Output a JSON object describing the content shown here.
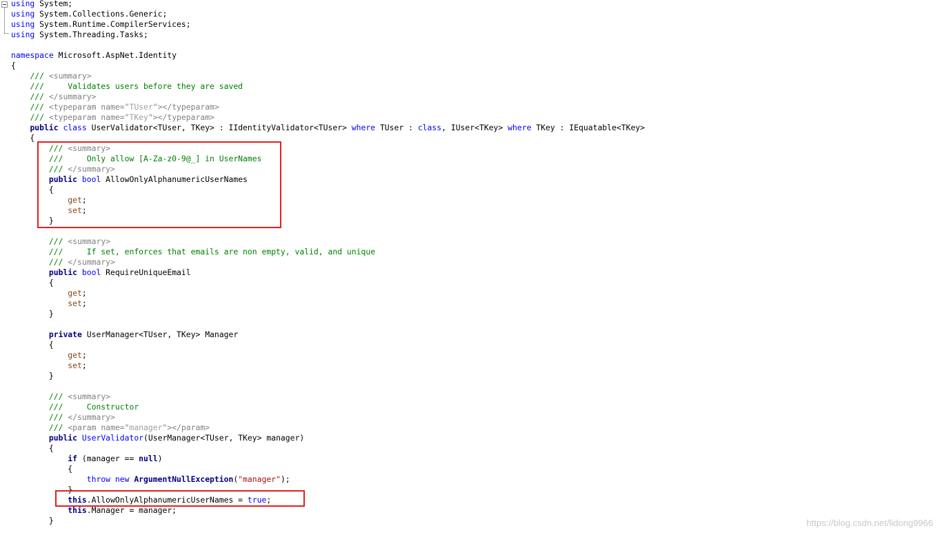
{
  "colors": {
    "keyword": "#0000ff",
    "keyword_bold": "#000080",
    "comment": "#008000",
    "xml_doc": "#808080",
    "string": "#a31515",
    "accessor": "#8b4513",
    "highlight_border": "#e02020",
    "background": "#ffffff"
  },
  "editor": {
    "outline_icon": "collapse-minus-icon",
    "lines": [
      [
        {
          "t": "kw",
          "s": "using"
        },
        {
          "t": "def",
          "s": " System;"
        }
      ],
      [
        {
          "t": "kw",
          "s": "using"
        },
        {
          "t": "def",
          "s": " System.Collections.Generic;"
        }
      ],
      [
        {
          "t": "kw",
          "s": "using"
        },
        {
          "t": "def",
          "s": " System.Runtime.CompilerServices;"
        }
      ],
      [
        {
          "t": "kw",
          "s": "using"
        },
        {
          "t": "def",
          "s": " System.Threading.Tasks;"
        }
      ],
      [],
      [
        {
          "t": "kw",
          "s": "namespace"
        },
        {
          "t": "def",
          "s": " Microsoft.AspNet.Identity"
        }
      ],
      [
        {
          "t": "def",
          "s": "{"
        }
      ],
      [
        {
          "t": "def",
          "s": "    "
        },
        {
          "t": "cmt",
          "s": "/// "
        },
        {
          "t": "xml",
          "s": "<summary>"
        }
      ],
      [
        {
          "t": "def",
          "s": "    "
        },
        {
          "t": "cmt",
          "s": "///     Validates users before they are saved"
        }
      ],
      [
        {
          "t": "def",
          "s": "    "
        },
        {
          "t": "cmt",
          "s": "/// "
        },
        {
          "t": "xml",
          "s": "</summary>"
        }
      ],
      [
        {
          "t": "def",
          "s": "    "
        },
        {
          "t": "cmt",
          "s": "/// "
        },
        {
          "t": "xml",
          "s": "<typeparam name=\""
        },
        {
          "t": "xmlv",
          "s": "TUser"
        },
        {
          "t": "xml",
          "s": "\"></typeparam>"
        }
      ],
      [
        {
          "t": "def",
          "s": "    "
        },
        {
          "t": "cmt",
          "s": "/// "
        },
        {
          "t": "xml",
          "s": "<typeparam name=\""
        },
        {
          "t": "xmlv",
          "s": "TKey"
        },
        {
          "t": "xml",
          "s": "\"></typeparam>"
        }
      ],
      [
        {
          "t": "def",
          "s": "    "
        },
        {
          "t": "kwb",
          "s": "public"
        },
        {
          "t": "def",
          "s": " "
        },
        {
          "t": "kw",
          "s": "class"
        },
        {
          "t": "def",
          "s": " UserValidator<TUser, TKey> : IIdentityValidator<TUser> "
        },
        {
          "t": "kw",
          "s": "where"
        },
        {
          "t": "def",
          "s": " TUser : "
        },
        {
          "t": "kw",
          "s": "class"
        },
        {
          "t": "def",
          "s": ", IUser<TKey> "
        },
        {
          "t": "kw",
          "s": "where"
        },
        {
          "t": "def",
          "s": " TKey : IEquatable<TKey>"
        }
      ],
      [
        {
          "t": "def",
          "s": "    {"
        }
      ],
      [
        {
          "t": "def",
          "s": "        "
        },
        {
          "t": "cmt",
          "s": "/// "
        },
        {
          "t": "xml",
          "s": "<summary>"
        }
      ],
      [
        {
          "t": "def",
          "s": "        "
        },
        {
          "t": "cmt",
          "s": "///     Only allow [A-Za-z0-9@_] in UserNames"
        }
      ],
      [
        {
          "t": "def",
          "s": "        "
        },
        {
          "t": "cmt",
          "s": "/// "
        },
        {
          "t": "xml",
          "s": "</summary>"
        }
      ],
      [
        {
          "t": "def",
          "s": "        "
        },
        {
          "t": "kwb",
          "s": "public"
        },
        {
          "t": "def",
          "s": " "
        },
        {
          "t": "kw",
          "s": "bool"
        },
        {
          "t": "def",
          "s": " AllowOnlyAlphanumericUserNames"
        }
      ],
      [
        {
          "t": "def",
          "s": "        {"
        }
      ],
      [
        {
          "t": "def",
          "s": "            "
        },
        {
          "t": "acc",
          "s": "get"
        },
        {
          "t": "def",
          "s": ";"
        }
      ],
      [
        {
          "t": "def",
          "s": "            "
        },
        {
          "t": "acc",
          "s": "set"
        },
        {
          "t": "def",
          "s": ";"
        }
      ],
      [
        {
          "t": "def",
          "s": "        }"
        }
      ],
      [],
      [
        {
          "t": "def",
          "s": "        "
        },
        {
          "t": "cmt",
          "s": "/// "
        },
        {
          "t": "xml",
          "s": "<summary>"
        }
      ],
      [
        {
          "t": "def",
          "s": "        "
        },
        {
          "t": "cmt",
          "s": "///     If set, enforces that emails are non empty, valid, and unique"
        }
      ],
      [
        {
          "t": "def",
          "s": "        "
        },
        {
          "t": "cmt",
          "s": "/// "
        },
        {
          "t": "xml",
          "s": "</summary>"
        }
      ],
      [
        {
          "t": "def",
          "s": "        "
        },
        {
          "t": "kwb",
          "s": "public"
        },
        {
          "t": "def",
          "s": " "
        },
        {
          "t": "kw",
          "s": "bool"
        },
        {
          "t": "def",
          "s": " RequireUniqueEmail"
        }
      ],
      [
        {
          "t": "def",
          "s": "        {"
        }
      ],
      [
        {
          "t": "def",
          "s": "            "
        },
        {
          "t": "acc",
          "s": "get"
        },
        {
          "t": "def",
          "s": ";"
        }
      ],
      [
        {
          "t": "def",
          "s": "            "
        },
        {
          "t": "acc",
          "s": "set"
        },
        {
          "t": "def",
          "s": ";"
        }
      ],
      [
        {
          "t": "def",
          "s": "        }"
        }
      ],
      [],
      [
        {
          "t": "def",
          "s": "        "
        },
        {
          "t": "kwb",
          "s": "private"
        },
        {
          "t": "def",
          "s": " UserManager<TUser, TKey> Manager"
        }
      ],
      [
        {
          "t": "def",
          "s": "        {"
        }
      ],
      [
        {
          "t": "def",
          "s": "            "
        },
        {
          "t": "acc",
          "s": "get"
        },
        {
          "t": "def",
          "s": ";"
        }
      ],
      [
        {
          "t": "def",
          "s": "            "
        },
        {
          "t": "acc",
          "s": "set"
        },
        {
          "t": "def",
          "s": ";"
        }
      ],
      [
        {
          "t": "def",
          "s": "        }"
        }
      ],
      [],
      [
        {
          "t": "def",
          "s": "        "
        },
        {
          "t": "cmt",
          "s": "/// "
        },
        {
          "t": "xml",
          "s": "<summary>"
        }
      ],
      [
        {
          "t": "def",
          "s": "        "
        },
        {
          "t": "cmt",
          "s": "///     Constructor"
        }
      ],
      [
        {
          "t": "def",
          "s": "        "
        },
        {
          "t": "cmt",
          "s": "/// "
        },
        {
          "t": "xml",
          "s": "</summary>"
        }
      ],
      [
        {
          "t": "def",
          "s": "        "
        },
        {
          "t": "cmt",
          "s": "/// "
        },
        {
          "t": "xml",
          "s": "<param name=\""
        },
        {
          "t": "xmlv",
          "s": "manager"
        },
        {
          "t": "xml",
          "s": "\"></param>"
        }
      ],
      [
        {
          "t": "def",
          "s": "        "
        },
        {
          "t": "kwb",
          "s": "public"
        },
        {
          "t": "def",
          "s": " "
        },
        {
          "t": "kw",
          "s": "UserValidator"
        },
        {
          "t": "def",
          "s": "(UserManager<TUser, TKey> manager)"
        }
      ],
      [
        {
          "t": "def",
          "s": "        {"
        }
      ],
      [
        {
          "t": "def",
          "s": "            "
        },
        {
          "t": "kwb",
          "s": "if"
        },
        {
          "t": "def",
          "s": " (manager == "
        },
        {
          "t": "bold",
          "s": "null"
        },
        {
          "t": "def",
          "s": ")"
        }
      ],
      [
        {
          "t": "def",
          "s": "            {"
        }
      ],
      [
        {
          "t": "def",
          "s": "                "
        },
        {
          "t": "kw",
          "s": "throw"
        },
        {
          "t": "def",
          "s": " "
        },
        {
          "t": "kw",
          "s": "new"
        },
        {
          "t": "def",
          "s": " "
        },
        {
          "t": "kwb",
          "s": "ArgumentNullException"
        },
        {
          "t": "def",
          "s": "("
        },
        {
          "t": "str",
          "s": "\"manager\""
        },
        {
          "t": "def",
          "s": ");"
        }
      ],
      [
        {
          "t": "def",
          "s": "            }"
        }
      ],
      [
        {
          "t": "def",
          "s": "            "
        },
        {
          "t": "bold",
          "s": "this"
        },
        {
          "t": "def",
          "s": ".AllowOnlyAlphanumericUserNames = "
        },
        {
          "t": "lit",
          "s": "true"
        },
        {
          "t": "def",
          "s": ";"
        }
      ],
      [
        {
          "t": "def",
          "s": "            "
        },
        {
          "t": "bold",
          "s": "this"
        },
        {
          "t": "def",
          "s": ".Manager = manager;"
        }
      ],
      [
        {
          "t": "def",
          "s": "        }"
        }
      ]
    ]
  },
  "watermark": "https://blog.csdn.net/lidong9966"
}
